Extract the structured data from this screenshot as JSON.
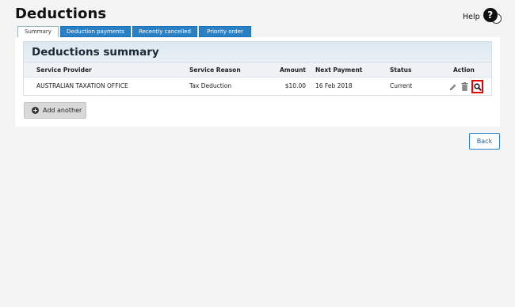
{
  "page": {
    "title": "Deductions"
  },
  "help": {
    "label": "Help",
    "icon": "help-icon",
    "glyph": "?"
  },
  "tabs": [
    {
      "label": "Summary",
      "active": true
    },
    {
      "label": "Deduction payments",
      "active": false
    },
    {
      "label": "Recently cancelled",
      "active": false
    },
    {
      "label": "Priority order",
      "active": false
    }
  ],
  "summary": {
    "title": "Deductions summary",
    "columns": {
      "provider": "Service Provider",
      "reason": "Service Reason",
      "amount": "Amount",
      "next_payment": "Next Payment",
      "status": "Status",
      "action": "Action"
    },
    "rows": [
      {
        "provider": "AUSTRALIAN TAXATION OFFICE",
        "reason": "Tax Deduction",
        "amount": "$10.00",
        "next_payment": "16 Feb 2018",
        "status": "Current",
        "actions": [
          "pencil-icon",
          "trash-icon",
          "magnifier-icon"
        ]
      }
    ]
  },
  "buttons": {
    "add_another": "Add another",
    "back": "Back"
  },
  "colors": {
    "tab_blue": "#2a80c2",
    "highlight_red": "#ee0000",
    "panel_header": "#dce8f0"
  }
}
